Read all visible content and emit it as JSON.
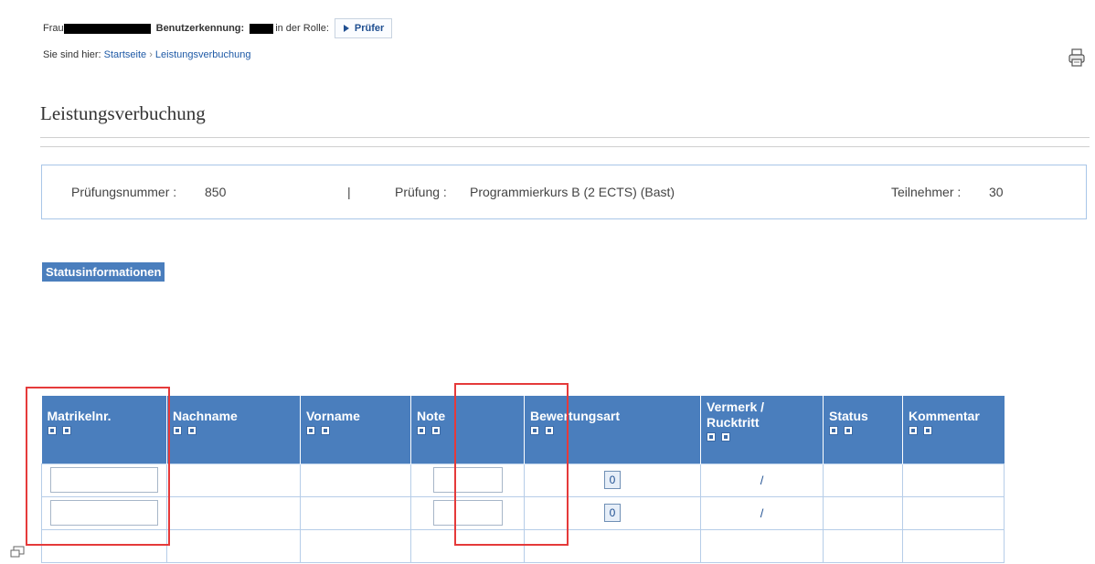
{
  "header": {
    "salutation": "Frau",
    "user_id_label": "Benutzerkennung:",
    "role_label": "in der Rolle:",
    "role_button": "Prüfer"
  },
  "breadcrumb": {
    "prefix": "Sie sind hier:",
    "home": "Startseite",
    "separator": "›",
    "current": "Leistungsverbuchung"
  },
  "page": {
    "title": "Leistungsverbuchung"
  },
  "info": {
    "exam_number_label": "Prüfungsnummer :",
    "exam_number": "850",
    "divider": "|",
    "exam_label": "Prüfung :",
    "exam_name": "Programmierkurs B (2 ECTS) (Bast)",
    "participants_label": "Teilnehmer :",
    "participants": "30"
  },
  "status_tab": "Statusinformationen",
  "table": {
    "columns": [
      {
        "line1": "Matrikelnr.",
        "line2": ""
      },
      {
        "line1": "Nachname",
        "line2": ""
      },
      {
        "line1": "Vorname",
        "line2": ""
      },
      {
        "line1": "Note",
        "line2": ""
      },
      {
        "line1": "Bewertungsart",
        "line2": ""
      },
      {
        "line1": "Vermerk /",
        "line2": "Rucktritt"
      },
      {
        "line1": "Status",
        "line2": ""
      },
      {
        "line1": "Kommentar",
        "line2": ""
      }
    ],
    "rows": [
      {
        "bewertungsart": "0",
        "vermerk": "/"
      },
      {
        "bewertungsart": "0",
        "vermerk": "/"
      }
    ]
  },
  "icons": {
    "print": "printer-icon",
    "sort": "sort-arrow-icon",
    "role": "play-arrow-icon",
    "corner": "window-icon"
  }
}
